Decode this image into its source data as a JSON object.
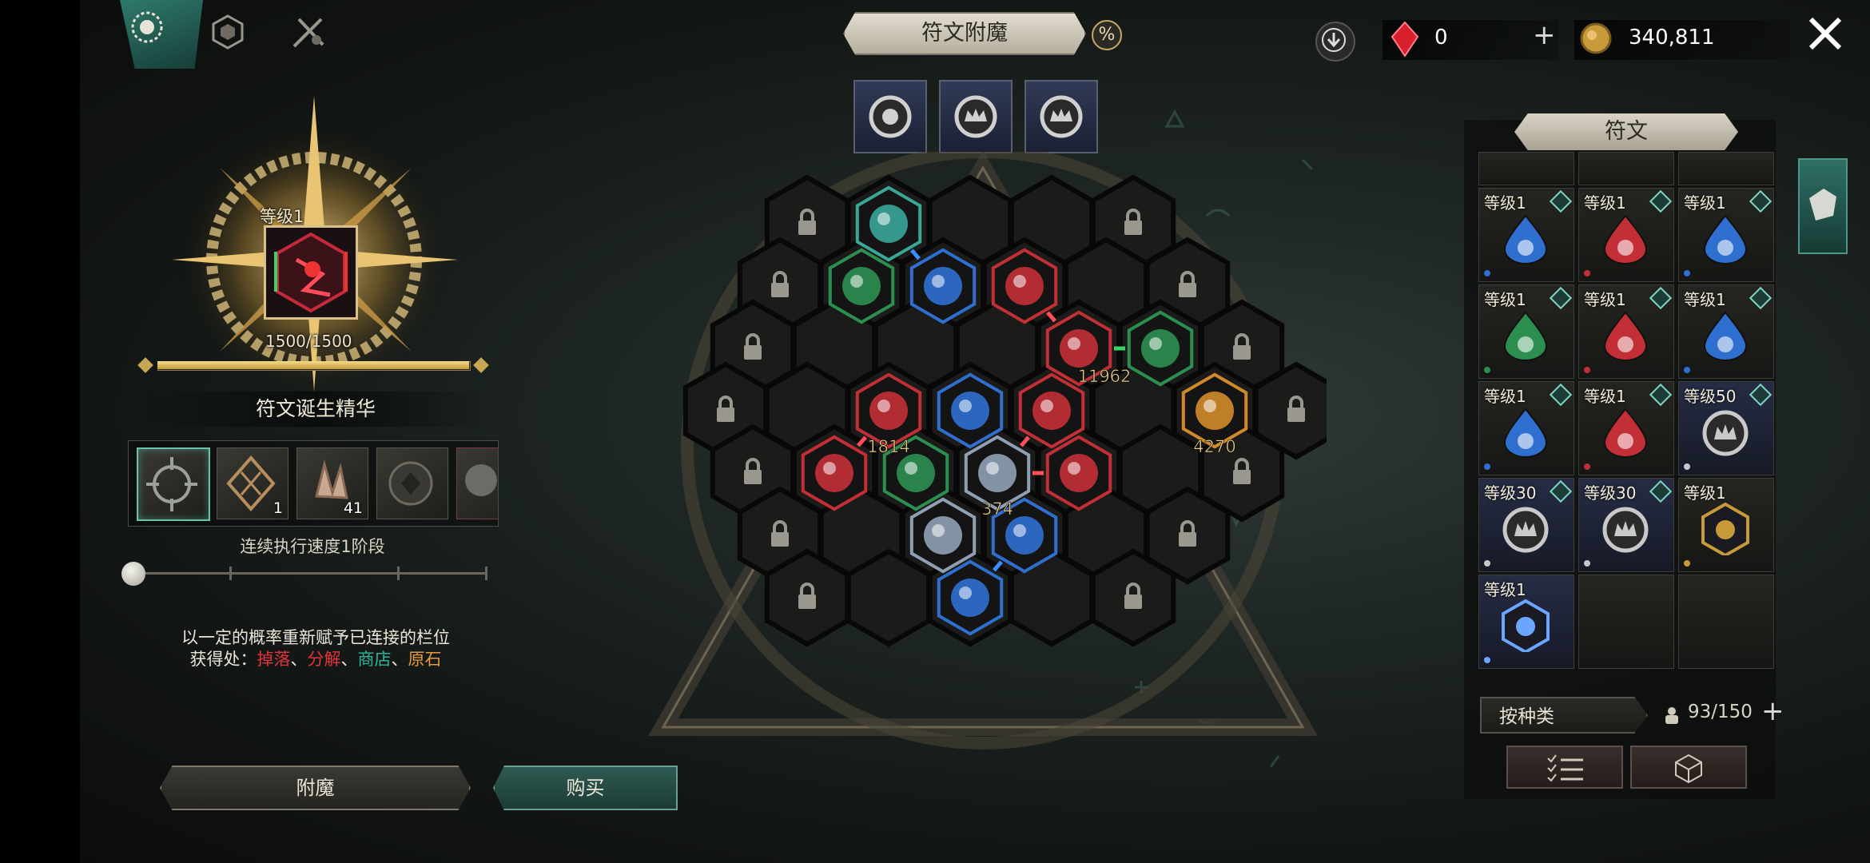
{
  "header": {
    "title": "符文附魔",
    "percent_icon": "%"
  },
  "currency": {
    "gem_value": "0",
    "gold_value": "340,811"
  },
  "left": {
    "level_label": "等级1",
    "progress_text": "1500/1500",
    "progress_fraction": 1.0,
    "essence_title": "符文诞生精华",
    "materials": [
      {
        "count": "",
        "selected": true
      },
      {
        "count": "1",
        "selected": false
      },
      {
        "count": "41",
        "selected": false
      },
      {
        "count": "",
        "selected": false
      },
      {
        "count": "",
        "selected": false
      }
    ],
    "speed_label": "连续执行速度1阶段",
    "desc_line1": "以一定的概率重新赋予已连接的栏位",
    "source_label": "获得处：",
    "src_drop": "掉落",
    "src_decompose": "分解",
    "src_shop": "商店",
    "src_ore": "原石",
    "sep": "、",
    "enchant_button": "附魔",
    "buy_button": "购买"
  },
  "board": {
    "values": [
      "11962",
      "1814",
      "4270",
      "374"
    ]
  },
  "right_panel": {
    "title": "符文",
    "cells": [
      {
        "level": "等级1",
        "gem": "blue-drop-gem",
        "color": "#2f6fd0"
      },
      {
        "level": "等级1",
        "gem": "red-drop-gem",
        "color": "#c22f36"
      },
      {
        "level": "等级1",
        "gem": "blue-drop-gem",
        "color": "#2f6fd0"
      },
      {
        "level": "等级1",
        "gem": "green-drop-gem",
        "color": "#2c8f50"
      },
      {
        "level": "等级1",
        "gem": "red-drop-gem",
        "color": "#c22f36"
      },
      {
        "level": "等级1",
        "gem": "blue-drop-gem",
        "color": "#2f6fd0"
      },
      {
        "level": "等级1",
        "gem": "blue-drop-gem",
        "color": "#2f6fd0"
      },
      {
        "level": "等级1",
        "gem": "red-drop-gem",
        "color": "#c22f36"
      },
      {
        "level": "等级50",
        "gem": "silver-crown-gem",
        "color": "#c9c9c9"
      },
      {
        "level": "等级30",
        "gem": "silver-crown-gem",
        "color": "#c9c9c9"
      },
      {
        "level": "等级30",
        "gem": "silver-crown-gem",
        "color": "#c9c9c9"
      },
      {
        "level": "等级1",
        "gem": "gold-hex-rune",
        "color": "#c79a3a"
      },
      {
        "level": "等级1",
        "gem": "lightning-hex-rune",
        "color": "#6aa6ff"
      }
    ],
    "sort_label": "按种类",
    "capacity": "93/150"
  }
}
